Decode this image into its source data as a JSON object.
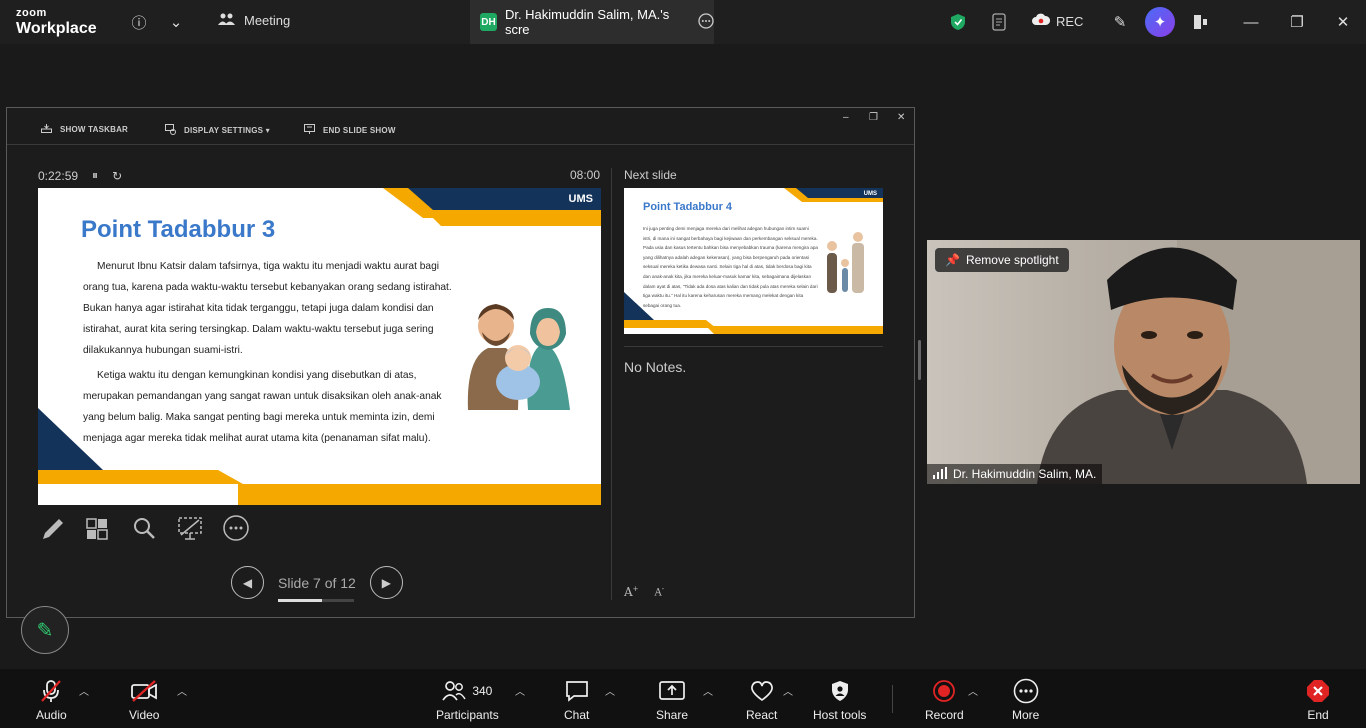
{
  "app": {
    "logo_line1": "zoom",
    "logo_line2": "Workplace"
  },
  "topbar": {
    "meeting_label": "Meeting",
    "tab_initials": "DH",
    "tab_title": "Dr. Hakimuddin Salim, MA.'s scre",
    "rec_label": "REC"
  },
  "presenter": {
    "show_taskbar": "SHOW TASKBAR",
    "display_settings": "DISPLAY SETTINGS ▾",
    "end_slide_show": "END SLIDE SHOW",
    "elapsed": "0:22:59",
    "clock": "08:00",
    "next_slide_label": "Next slide",
    "slide_counter": "Slide 7 of 12",
    "slide_progress": 0.583,
    "notes": "No Notes."
  },
  "slide": {
    "title": "Point Tadabbur 3",
    "logo": "UMS",
    "p1": "Menurut Ibnu Katsir dalam tafsirnya, tiga waktu itu menjadi waktu aurat bagi orang tua, karena pada waktu-waktu tersebut kebanyakan orang sedang istirahat. Bukan hanya agar istirahat kita tidak terganggu, tetapi juga dalam kondisi dan istirahat, aurat kita sering tersingkap. Dalam waktu-waktu tersebut juga sering dilakukannya hubungan suami-istri.",
    "p2": "Ketiga waktu itu dengan kemungkinan kondisi yang disebutkan di atas, merupakan pemandangan yang sangat rawan untuk disaksikan oleh anak-anak yang belum balig. Maka sangat penting bagi mereka untuk meminta izin, demi menjaga agar mereka tidak melihat aurat utama kita (penanaman sifat malu)."
  },
  "next_slide": {
    "title": "Point Tadabbur 4",
    "logo": "UMS",
    "body": "Ini juga penting demi menjaga mereka dari melihat adegan hubungan intim suami istri, di mana ini sangat berbahaya bagi kejiwaan dan perkembangan seksual mereka. Pada usia dan kasus tertentu bahkan bisa menyebabkan trauma (karena mengira apa yang dilihatnya adalah adegan kekerasan), yang bisa berpengaruh pada orientasi seksual mereka ketika dewasa nanti. Selain tiga hal di atas, tidak berdosa bagi kita dan anak-anak kita, jika mereka keluar-masuk kamar kita, sebagaimana dijelaskan dalam ayat di atas, \"Tidak ada dosa atas kalian dan tidak pula atas mereka selain dari tiga waktu itu.\" Hal itu karena keharusan mereka memang melekat dengan kita sebagai orang tua."
  },
  "video": {
    "spotlight_button": "Remove spotlight",
    "participant_name": "Dr. Hakimuddin Salim, MA."
  },
  "toolbar": {
    "audio": "Audio",
    "video": "Video",
    "participants": "Participants",
    "participants_count": "340",
    "chat": "Chat",
    "share": "Share",
    "react": "React",
    "host_tools": "Host tools",
    "record": "Record",
    "more": "More",
    "end": "End"
  },
  "colors": {
    "accent_blue": "#3a78c9",
    "navy": "#13335a",
    "gold": "#f5a800",
    "shield_green": "#1ea862",
    "record_red": "#e02424"
  }
}
